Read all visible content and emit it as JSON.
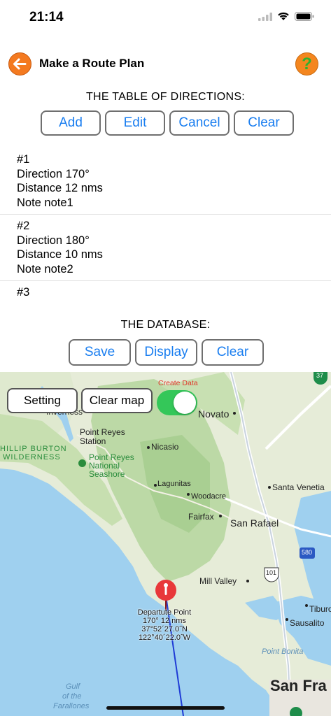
{
  "status_bar": {
    "time": "21:14"
  },
  "nav": {
    "title": "Make a Route Plan",
    "help_glyph": "?"
  },
  "directions": {
    "heading": "THE TABLE OF DIRECTIONS:",
    "buttons": [
      "Add",
      "Edit",
      "Cancel",
      "Clear"
    ],
    "entries": [
      {
        "index": "#1",
        "direction": "Direction 170°",
        "distance": "Distance 12 nms",
        "note": "Note note1"
      },
      {
        "index": "#2",
        "direction": "Direction 180°",
        "distance": "Distance 10 nms",
        "note": "Note note2"
      },
      {
        "index": "#3"
      }
    ]
  },
  "database": {
    "heading": "THE DATABASE:",
    "buttons": [
      "Save",
      "Display",
      "Clear"
    ]
  },
  "map": {
    "setting_label": "Setting",
    "clear_map_label": "Clear map",
    "create_data_label": "Create Data",
    "create_data_on": true,
    "places": {
      "inverness": "Inverness",
      "point_reyes_station": "Point Reyes\nStation",
      "point_reyes_station_1": "Point Reyes",
      "point_reyes_station_2": "Station",
      "phillip_burton": "HILLIP BURTON",
      "wilderness": "WILDERNESS",
      "nicasio": "Nicasio",
      "pr_seashore_1": "Point Reyes",
      "pr_seashore_2": "National",
      "pr_seashore_3": "Seashore",
      "novato": "Novato",
      "lagunitas": "Lagunitas",
      "woodacre": "Woodacre",
      "santa_venetia": "Santa Venetia",
      "fairfax": "Fairfax",
      "san_rafael": "San Rafael",
      "mill_valley": "Mill Valley",
      "tiburon": "Tiburo",
      "sausalito": "Sausalito",
      "point_bonita": "Point Bonita",
      "gulf_1": "Gulf",
      "gulf_2": "of the",
      "gulf_3": "Farallones",
      "san_francisco": "San Fra",
      "hwy_101": "101",
      "hwy_580": "580",
      "hwy_37": "37"
    },
    "pin": {
      "name": "Departute Point",
      "course": "170° 12 nms",
      "lat": "37°52´27.0˝N",
      "lon": "122°40´22.0˝W"
    }
  },
  "colors": {
    "accent_blue": "#1a7ef0",
    "back_orange": "#f47a20",
    "toggle_green": "#34c759",
    "pin_red": "#e8383a",
    "route_line": "#1f3bd6"
  },
  "icons": [
    "arrow-left-icon",
    "help-icon",
    "wifi-icon",
    "battery-icon",
    "signal-icon",
    "map-pin-icon"
  ]
}
